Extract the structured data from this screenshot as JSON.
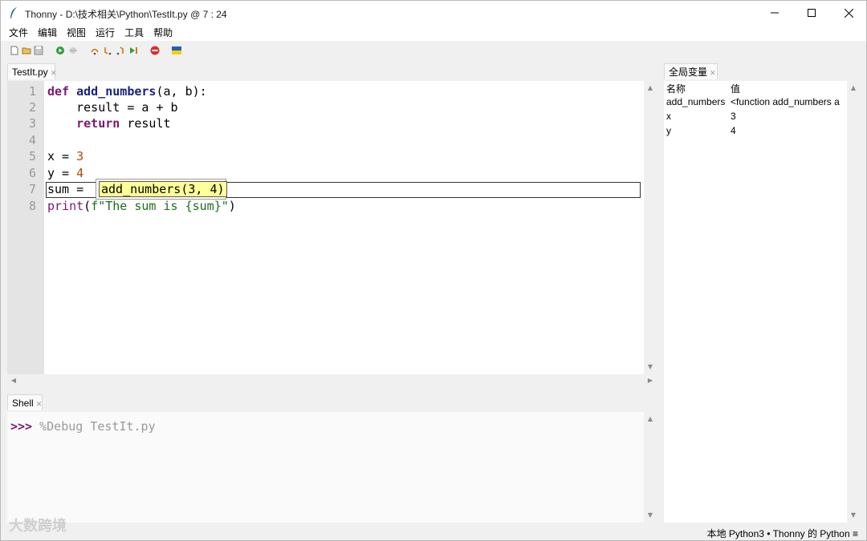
{
  "window": {
    "title": "Thonny  -  D:\\技术相关\\Python\\TestIt.py  @  7 : 24"
  },
  "menu": {
    "items": [
      "文件",
      "编辑",
      "视图",
      "运行",
      "工具",
      "帮助"
    ]
  },
  "toolbar": {
    "icons": [
      "new-file-icon",
      "open-file-icon",
      "save-icon",
      "run-icon",
      "debug-icon",
      "step-over-icon",
      "step-into-icon",
      "step-out-icon",
      "resume-icon",
      "stop-icon",
      "ukraine-flag-icon"
    ]
  },
  "editor": {
    "tab_label": "TestIt.py",
    "line_numbers": [
      "1",
      "2",
      "3",
      "4",
      "5",
      "6",
      "7",
      "8"
    ],
    "lines": {
      "l1_kw": "def",
      "l1_fn": "add_numbers",
      "l1_rest": "(a, b):",
      "l2_rest": "    result = a + b",
      "l3_indent": "    ",
      "l3_kw": "return",
      "l3_rest": " result",
      "l5_a": "x = ",
      "l5_num": "3",
      "l6_a": "y = ",
      "l6_num": "4",
      "l7_a": "sum = ",
      "l8_builtin": "print",
      "l8_paren": "(",
      "l8_str": "f\"The sum is {sum}\"",
      "l8_close": ")"
    },
    "evaluation_popup": "add_numbers(3, 4)"
  },
  "shell": {
    "tab_label": "Shell",
    "prompt": ">>>",
    "command": " %Debug TestIt.py"
  },
  "variables": {
    "tab_label": "全局变量",
    "header_name": "名称",
    "header_value": "值",
    "rows": [
      {
        "name": "add_numbers",
        "value": "<function add_numbers a"
      },
      {
        "name": "x",
        "value": "3"
      },
      {
        "name": "y",
        "value": "4"
      }
    ]
  },
  "status": {
    "text": "本地 Python3  •  Thonny 的 Python  ≡"
  },
  "watermark": "大数跨境",
  "colors": {
    "keyword": "#7a1a6e",
    "function_name": "#1a237e",
    "number": "#b04a00",
    "string": "#1b6e1b",
    "eval_highlight": "#ffff99"
  }
}
